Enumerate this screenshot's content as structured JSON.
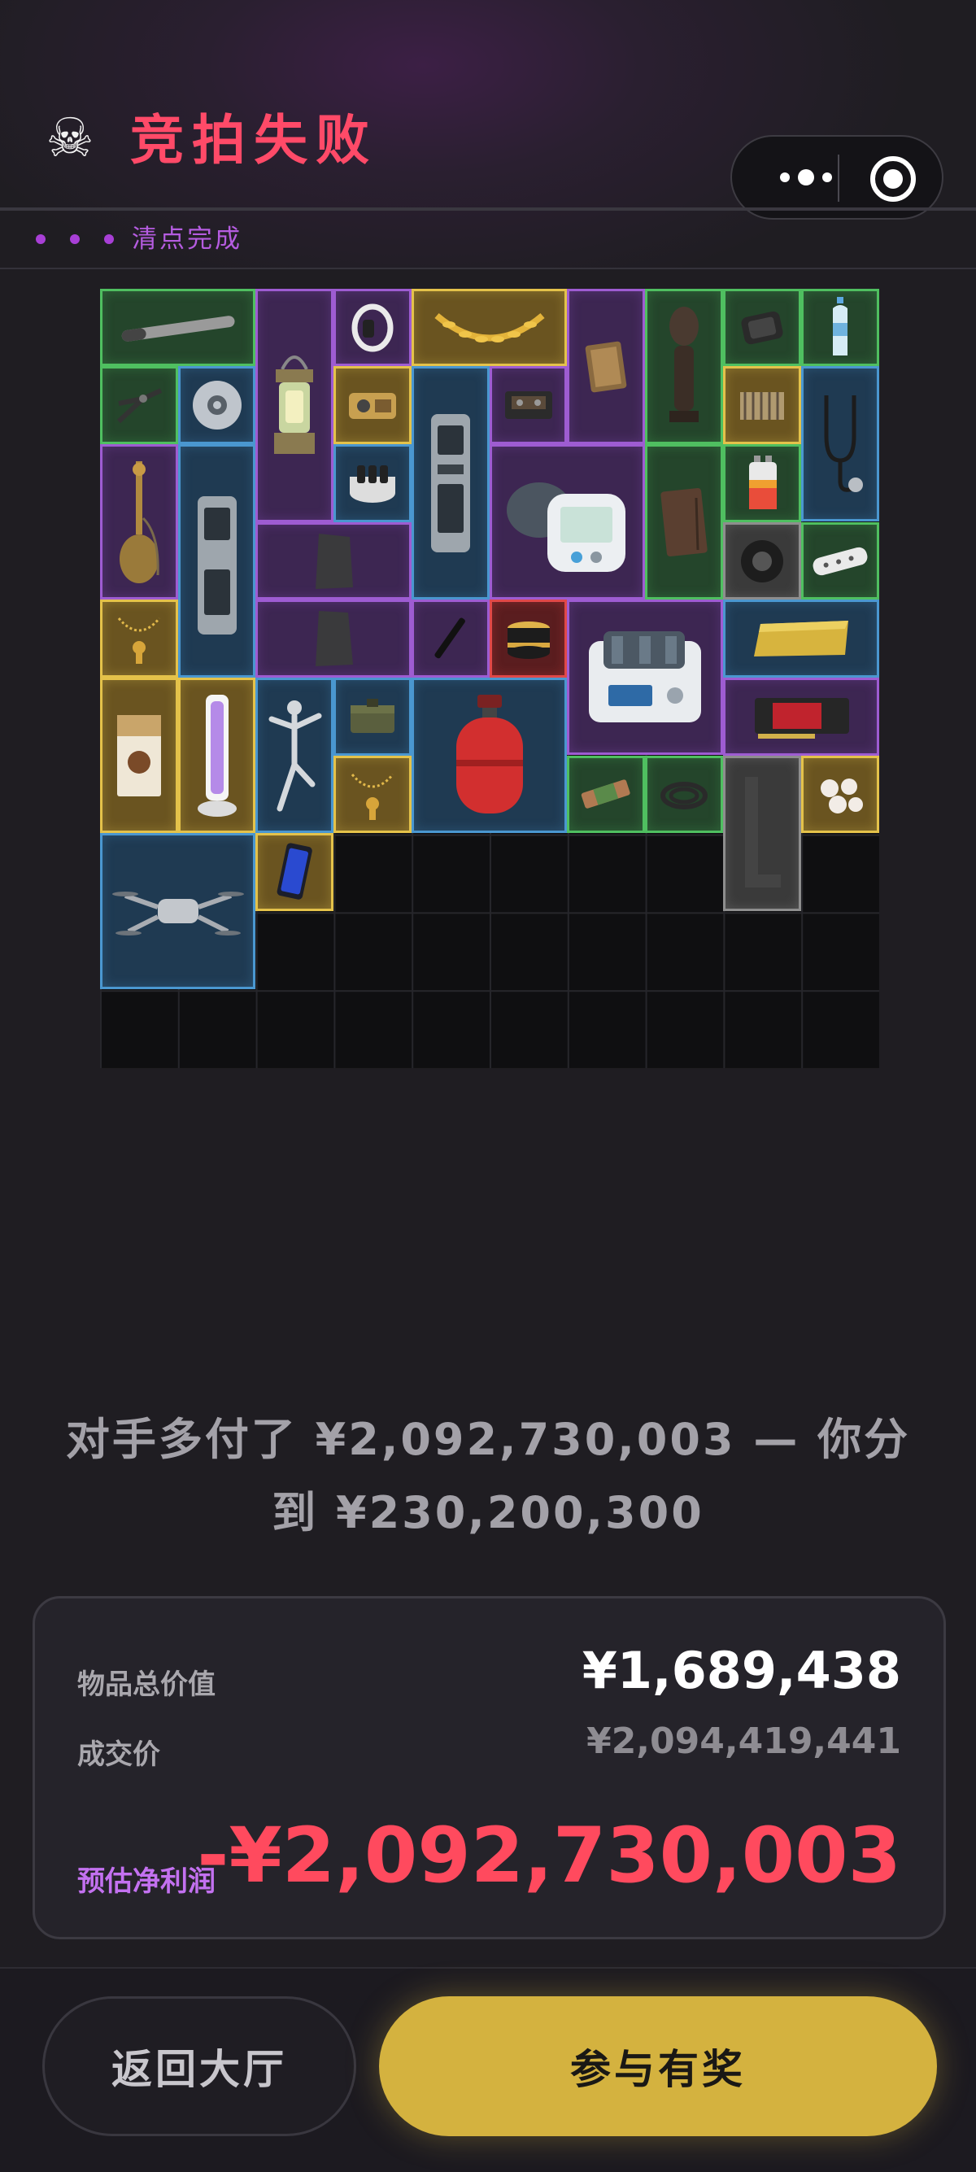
{
  "header": {
    "skull_icon": "skull-icon",
    "title": "竞拍失败",
    "title_color": "#ff4a68"
  },
  "capsule": {
    "more_icon": "more-dots-icon",
    "close_icon": "target-circle-icon"
  },
  "status": {
    "text": "清点完成",
    "dot_color": "#a83fd6"
  },
  "inventory": {
    "rarity_colors": {
      "green": "#4fbf60",
      "blue": "#4a97d0",
      "purple": "#9e5cd2",
      "gold": "#e4c24a",
      "red": "#e04848",
      "gray": "#8e8e8e"
    },
    "items": [
      {
        "name": "pipe-item",
        "rarity": "green"
      },
      {
        "name": "lantern-item",
        "rarity": "purple"
      },
      {
        "name": "smart-band-item",
        "rarity": "purple"
      },
      {
        "name": "laurel-wreath-item",
        "rarity": "gold"
      },
      {
        "name": "old-book-item",
        "rarity": "purple"
      },
      {
        "name": "wooden-statue-item",
        "rarity": "green"
      },
      {
        "name": "hard-drive-item",
        "rarity": "green"
      },
      {
        "name": "water-bottle-item",
        "rarity": "green"
      },
      {
        "name": "pliers-item",
        "rarity": "green"
      },
      {
        "name": "disc-item",
        "rarity": "blue"
      },
      {
        "name": "gadget-item",
        "rarity": "gold"
      },
      {
        "name": "device-tall-item",
        "rarity": "blue"
      },
      {
        "name": "cassette-item",
        "rarity": "purple"
      },
      {
        "name": "blood-pressure-monitor-item",
        "rarity": "purple"
      },
      {
        "name": "heatsink-item",
        "rarity": "gold"
      },
      {
        "name": "stethoscope-item",
        "rarity": "blue"
      },
      {
        "name": "hookah-item",
        "rarity": "purple"
      },
      {
        "name": "electronic-device-item",
        "rarity": "blue"
      },
      {
        "name": "capacitor-item",
        "rarity": "blue"
      },
      {
        "name": "leather-notebook-item",
        "rarity": "green"
      },
      {
        "name": "battery-item",
        "rarity": "green"
      },
      {
        "name": "stone-slab-item",
        "rarity": "purple"
      },
      {
        "name": "tape-item",
        "rarity": "gray"
      },
      {
        "name": "power-strip-item",
        "rarity": "green"
      },
      {
        "name": "necklace-item",
        "rarity": "gold"
      },
      {
        "name": "stone-slab-2-item",
        "rarity": "purple"
      },
      {
        "name": "pen-item",
        "rarity": "purple"
      },
      {
        "name": "cosmetic-jar-item",
        "rarity": "red"
      },
      {
        "name": "lab-machine-item",
        "rarity": "purple"
      },
      {
        "name": "gold-bar-item",
        "rarity": "blue"
      },
      {
        "name": "coffee-box-item",
        "rarity": "gold"
      },
      {
        "name": "uv-lamp-item",
        "rarity": "gold"
      },
      {
        "name": "dancer-statue-item",
        "rarity": "blue"
      },
      {
        "name": "ammo-box-item",
        "rarity": "blue"
      },
      {
        "name": "gas-tank-item",
        "rarity": "blue"
      },
      {
        "name": "graphics-card-item",
        "rarity": "purple"
      },
      {
        "name": "pendant-item",
        "rarity": "gold"
      },
      {
        "name": "snack-bar-item",
        "rarity": "green"
      },
      {
        "name": "cable-item",
        "rarity": "green"
      },
      {
        "name": "l-bracket-item",
        "rarity": "gray"
      },
      {
        "name": "pearls-item",
        "rarity": "gold"
      },
      {
        "name": "drone-item",
        "rarity": "blue"
      },
      {
        "name": "smartphone-item",
        "rarity": "gold"
      }
    ]
  },
  "result": {
    "message": "对手多付了 ¥2,092,730,003 — 你分到 ¥230,200,300"
  },
  "summary": {
    "total_value_label": "物品总价值",
    "total_value": "¥1,689,438",
    "deal_price_label": "成交价",
    "deal_price": "¥2,094,419,441",
    "profit_label": "预估净利润",
    "profit": "-¥2,092,730,003",
    "profit_color": "#ff4a5e"
  },
  "buttons": {
    "back_label": "返回大厅",
    "join_label": "参与有奖",
    "join_color": "#d4b23f"
  }
}
